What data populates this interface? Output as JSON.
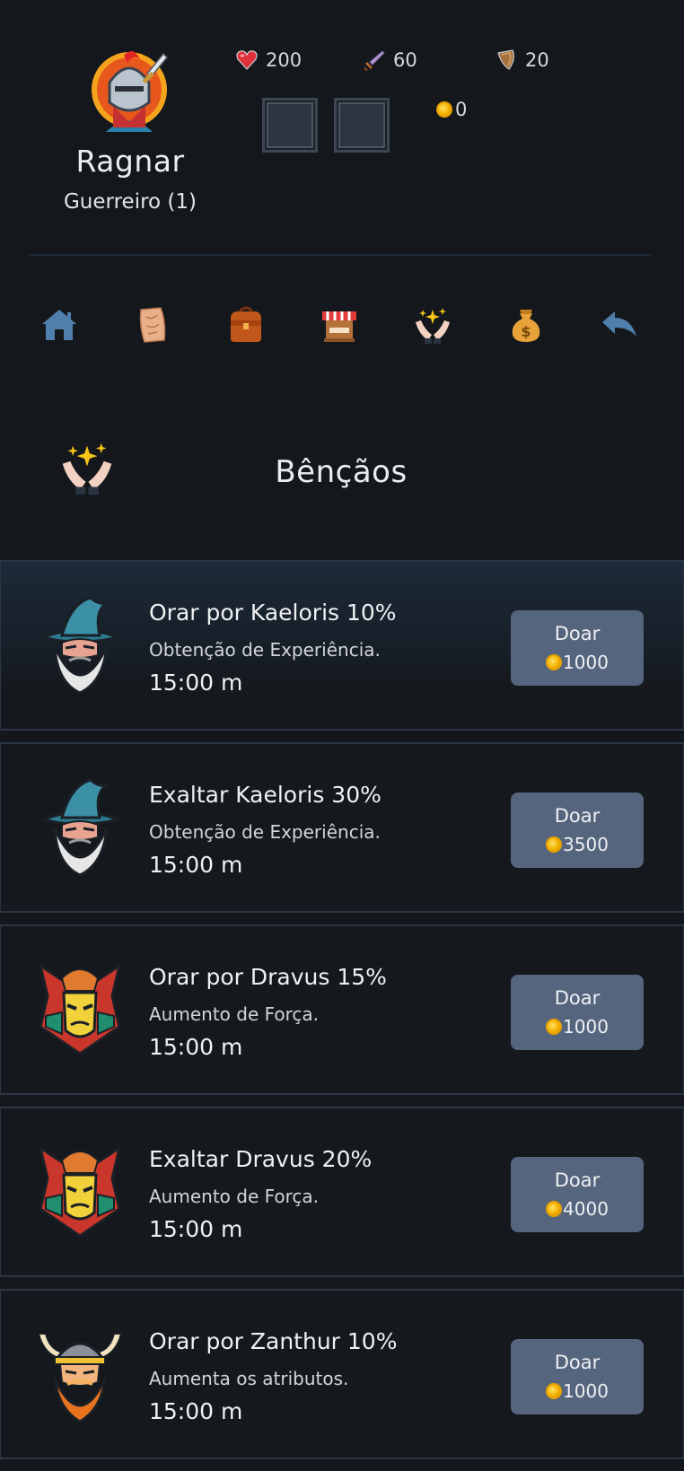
{
  "player": {
    "name": "Ragnar",
    "class_level": "Guerreiro (1)",
    "avatar_icon": "knight-avatar-icon"
  },
  "stats": {
    "hp": "200",
    "attack": "60",
    "defense": "20",
    "gold": "0"
  },
  "nav": {
    "items": [
      "home-icon",
      "map-scroll-icon",
      "backpack-icon",
      "shop-icon",
      "blessing-hands-icon",
      "money-bag-icon",
      "back-arrow-icon"
    ]
  },
  "section": {
    "title": "Bênçãos",
    "icon": "blessing-hands-icon"
  },
  "blessings": [
    {
      "title": "Orar por Kaeloris 10%",
      "desc": "Obtenção de Experiência.",
      "time": "15:00 m",
      "button": "Doar",
      "cost": "1000",
      "icon": "wizard-icon"
    },
    {
      "title": "Exaltar Kaeloris 30%",
      "desc": "Obtenção de Experiência.",
      "time": "15:00 m",
      "button": "Doar",
      "cost": "3500",
      "icon": "wizard-icon"
    },
    {
      "title": "Orar por Dravus 15%",
      "desc": "Aumento de Força.",
      "time": "15:00 m",
      "button": "Doar",
      "cost": "1000",
      "icon": "samurai-icon"
    },
    {
      "title": "Exaltar Dravus 20%",
      "desc": "Aumento de Força.",
      "time": "15:00 m",
      "button": "Doar",
      "cost": "4000",
      "icon": "samurai-icon"
    },
    {
      "title": "Orar por Zanthur 10%",
      "desc": "Aumenta os atributos.",
      "time": "15:00 m",
      "button": "Doar",
      "cost": "1000",
      "icon": "viking-icon"
    }
  ],
  "colors": {
    "background": "#14171b",
    "button": "#56657e",
    "gold": "#f3b300"
  }
}
